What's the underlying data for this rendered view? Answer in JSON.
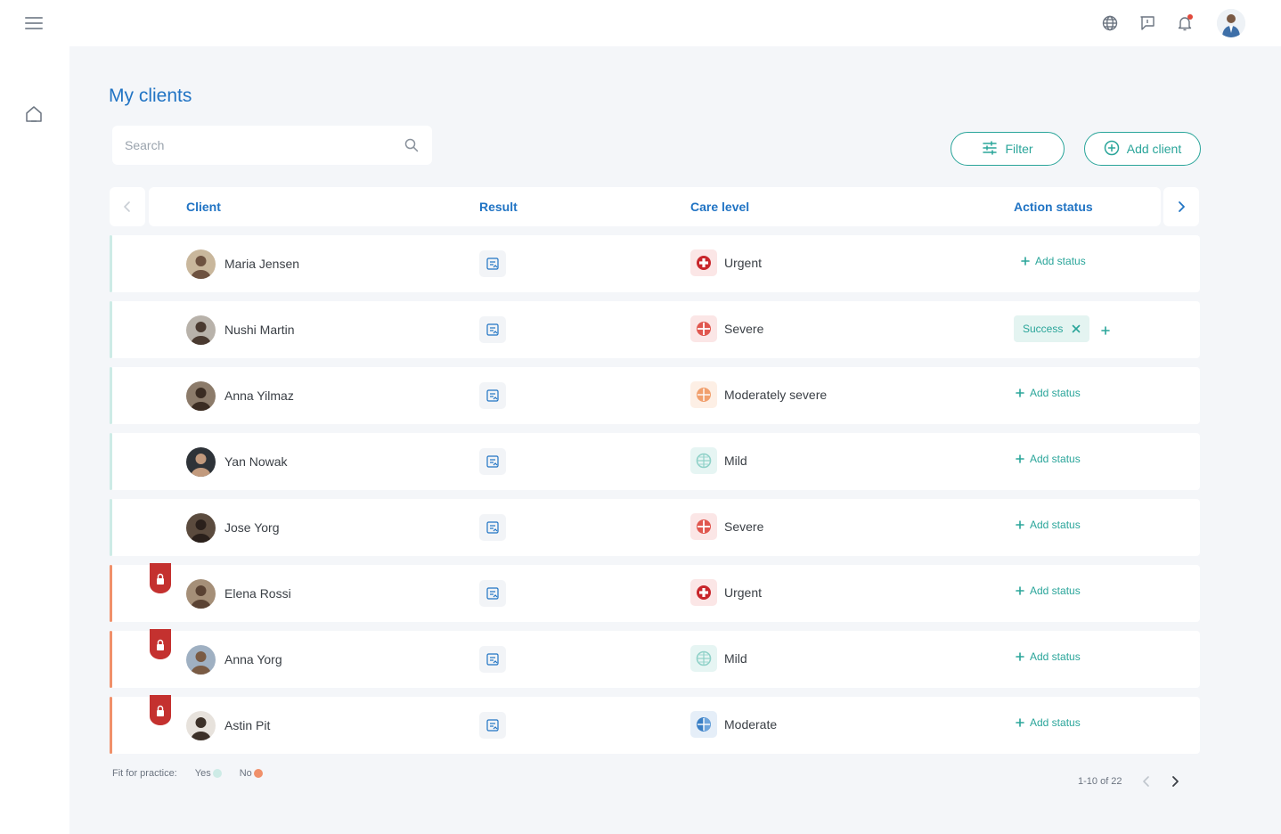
{
  "page": {
    "title": "My clients"
  },
  "search": {
    "placeholder": "Search"
  },
  "toolbar": {
    "filter_label": "Filter",
    "add_client_label": "Add client"
  },
  "table": {
    "columns": [
      "Client",
      "Result",
      "Care level",
      "Action status"
    ],
    "rows": [
      {
        "name": "Maria Jensen",
        "care_level": "Urgent",
        "care_key": "urgent",
        "fit": "yes",
        "status": "Add status"
      },
      {
        "name": "Nushi Martin",
        "care_level": "Severe",
        "care_key": "severe",
        "fit": "yes",
        "status_chip": "Success"
      },
      {
        "name": "Anna Yilmaz",
        "care_level": "Moderately severe",
        "care_key": "modsevere",
        "fit": "yes",
        "status": "Add status"
      },
      {
        "name": "Yan Nowak",
        "care_level": "Mild",
        "care_key": "mild",
        "fit": "yes",
        "status": "Add status"
      },
      {
        "name": "Jose Yorg",
        "care_level": "Severe",
        "care_key": "severe",
        "fit": "yes",
        "status": "Add status"
      },
      {
        "name": "Elena Rossi",
        "care_level": "Urgent",
        "care_key": "urgent",
        "fit": "no",
        "status": "Add status"
      },
      {
        "name": "Anna Yorg",
        "care_level": "Mild",
        "care_key": "mild",
        "fit": "no",
        "status": "Add status"
      },
      {
        "name": "Astin Pit",
        "care_level": "Moderate",
        "care_key": "moderate",
        "fit": "no",
        "status": "Add status"
      }
    ]
  },
  "legend": {
    "label": "Fit for practice:",
    "yes": "Yes",
    "no": "No"
  },
  "pagination": {
    "range": "1-10 of 22"
  },
  "colors": {
    "accent": "#2aa59a",
    "title_blue": "#2174c4",
    "fit_yes": "#cdebe6",
    "fit_no": "#f0906a",
    "urgent": "#c8262b",
    "severe": "#e0574f",
    "modsevere": "#f1a06e",
    "mild": "#8fd1c8",
    "moderate": "#3b80c6",
    "badge": "#c4312f"
  },
  "icons": {
    "menu": "hamburger-icon",
    "home": "home-icon",
    "globe": "globe-icon",
    "chat": "chat-icon",
    "bell": "bell-icon",
    "search": "search-icon",
    "filter": "sliders-icon",
    "add": "plus-circle-icon",
    "result": "report-icon",
    "lock": "lock-badge-icon",
    "close": "close-icon"
  }
}
